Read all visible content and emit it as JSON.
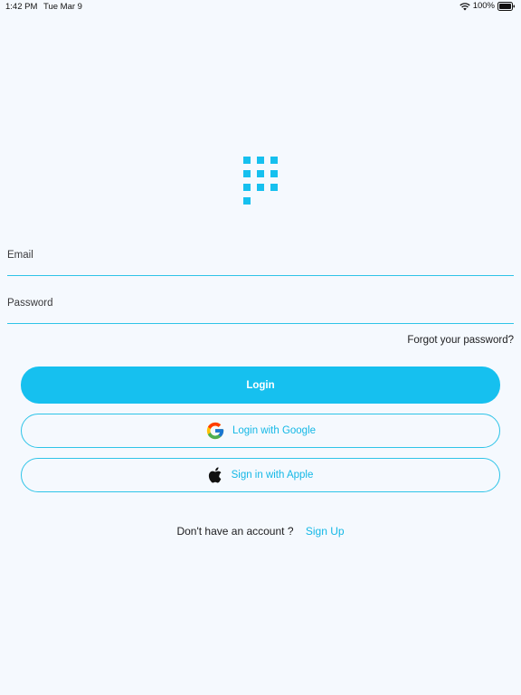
{
  "status_bar": {
    "time": "1:42 PM",
    "date": "Tue Mar 9",
    "battery": "100%"
  },
  "icons": {
    "logo": "app-logo-grid-icon",
    "wifi": "wifi-icon",
    "battery": "battery-icon",
    "google": "google-g-icon",
    "apple": "apple-icon"
  },
  "colors": {
    "accent": "#16c0ef",
    "background": "#f5f9fe",
    "text": "#1c1c1e"
  },
  "form": {
    "email_label": "Email",
    "password_label": "Password",
    "forgot_password": "Forgot your password?"
  },
  "buttons": {
    "login": "Login",
    "google": "Login with Google",
    "apple": "Sign in with Apple"
  },
  "signup": {
    "prompt": "Don't have an account ?",
    "link": "Sign Up"
  }
}
